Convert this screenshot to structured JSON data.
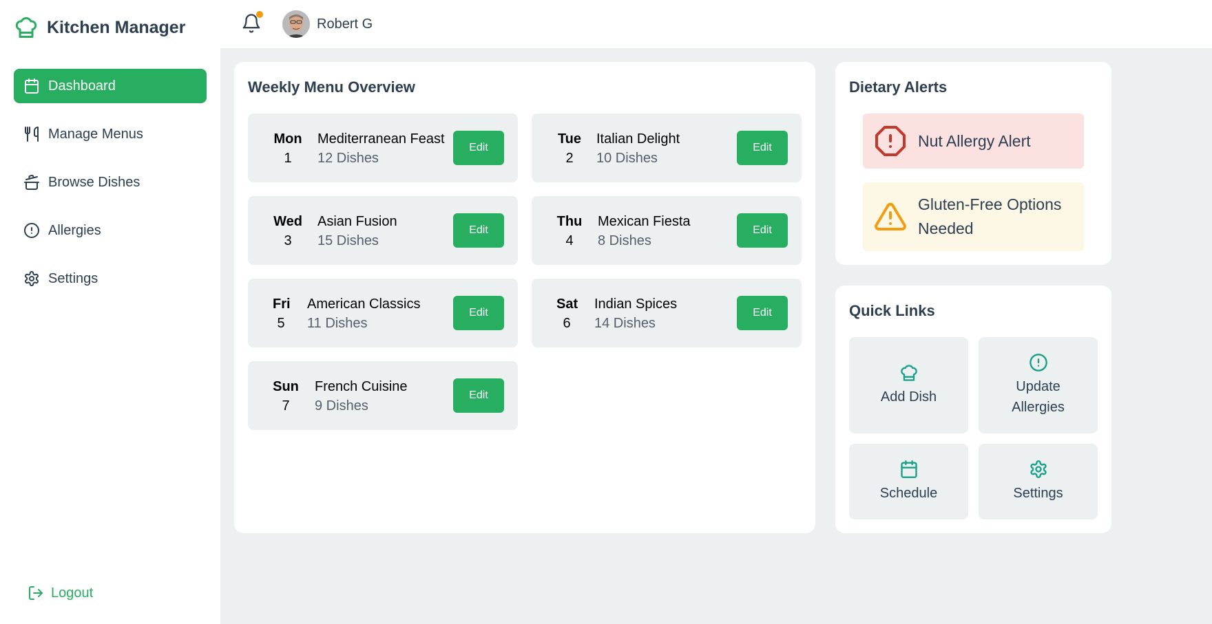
{
  "app": {
    "title": "Kitchen Manager",
    "brand_icon": "chef-hat-icon",
    "accent": "#27ae60"
  },
  "sidebar": {
    "items": [
      {
        "label": "Dashboard",
        "icon": "calendar-icon",
        "active": true
      },
      {
        "label": "Manage Menus",
        "icon": "utensils-icon",
        "active": false
      },
      {
        "label": "Browse Dishes",
        "icon": "pot-icon",
        "active": false
      },
      {
        "label": "Allergies",
        "icon": "alert-circle-icon",
        "active": false
      },
      {
        "label": "Settings",
        "icon": "gear-icon",
        "active": false
      }
    ],
    "logout": "Logout"
  },
  "header": {
    "user_name": "Robert G",
    "notification_dot_color": "#f39c12"
  },
  "weekly_menu": {
    "title": "Weekly Menu Overview",
    "edit_label": "Edit",
    "days": [
      {
        "day": "Mon",
        "num": "1",
        "menu": "Mediterranean Feast",
        "dishes": "12 Dishes"
      },
      {
        "day": "Tue",
        "num": "2",
        "menu": "Italian Delight",
        "dishes": "10 Dishes"
      },
      {
        "day": "Wed",
        "num": "3",
        "menu": "Asian Fusion",
        "dishes": "15 Dishes"
      },
      {
        "day": "Thu",
        "num": "4",
        "menu": "Mexican Fiesta",
        "dishes": "8 Dishes"
      },
      {
        "day": "Fri",
        "num": "5",
        "menu": "American Classics",
        "dishes": "11 Dishes"
      },
      {
        "day": "Sat",
        "num": "6",
        "menu": "Indian Spices",
        "dishes": "14 Dishes"
      },
      {
        "day": "Sun",
        "num": "7",
        "menu": "French Cuisine",
        "dishes": "9 Dishes"
      }
    ]
  },
  "dietary_alerts": {
    "title": "Dietary Alerts",
    "items": [
      {
        "text": "Nut Allergy Alert",
        "icon": "octagon-alert-icon",
        "color": "#c0392b"
      },
      {
        "text": "Gluten-Free Options Needed",
        "icon": "warning-triangle-icon",
        "color": "#f39c12"
      }
    ]
  },
  "quick_links": {
    "title": "Quick Links",
    "items": [
      {
        "label": "Add Dish",
        "icon": "chef-hat-icon"
      },
      {
        "label": "Update Allergies",
        "icon": "alert-circle-icon"
      },
      {
        "label": "Schedule",
        "icon": "calendar-icon"
      },
      {
        "label": "Settings",
        "icon": "gear-icon"
      }
    ],
    "icon_color": "#16a085"
  }
}
